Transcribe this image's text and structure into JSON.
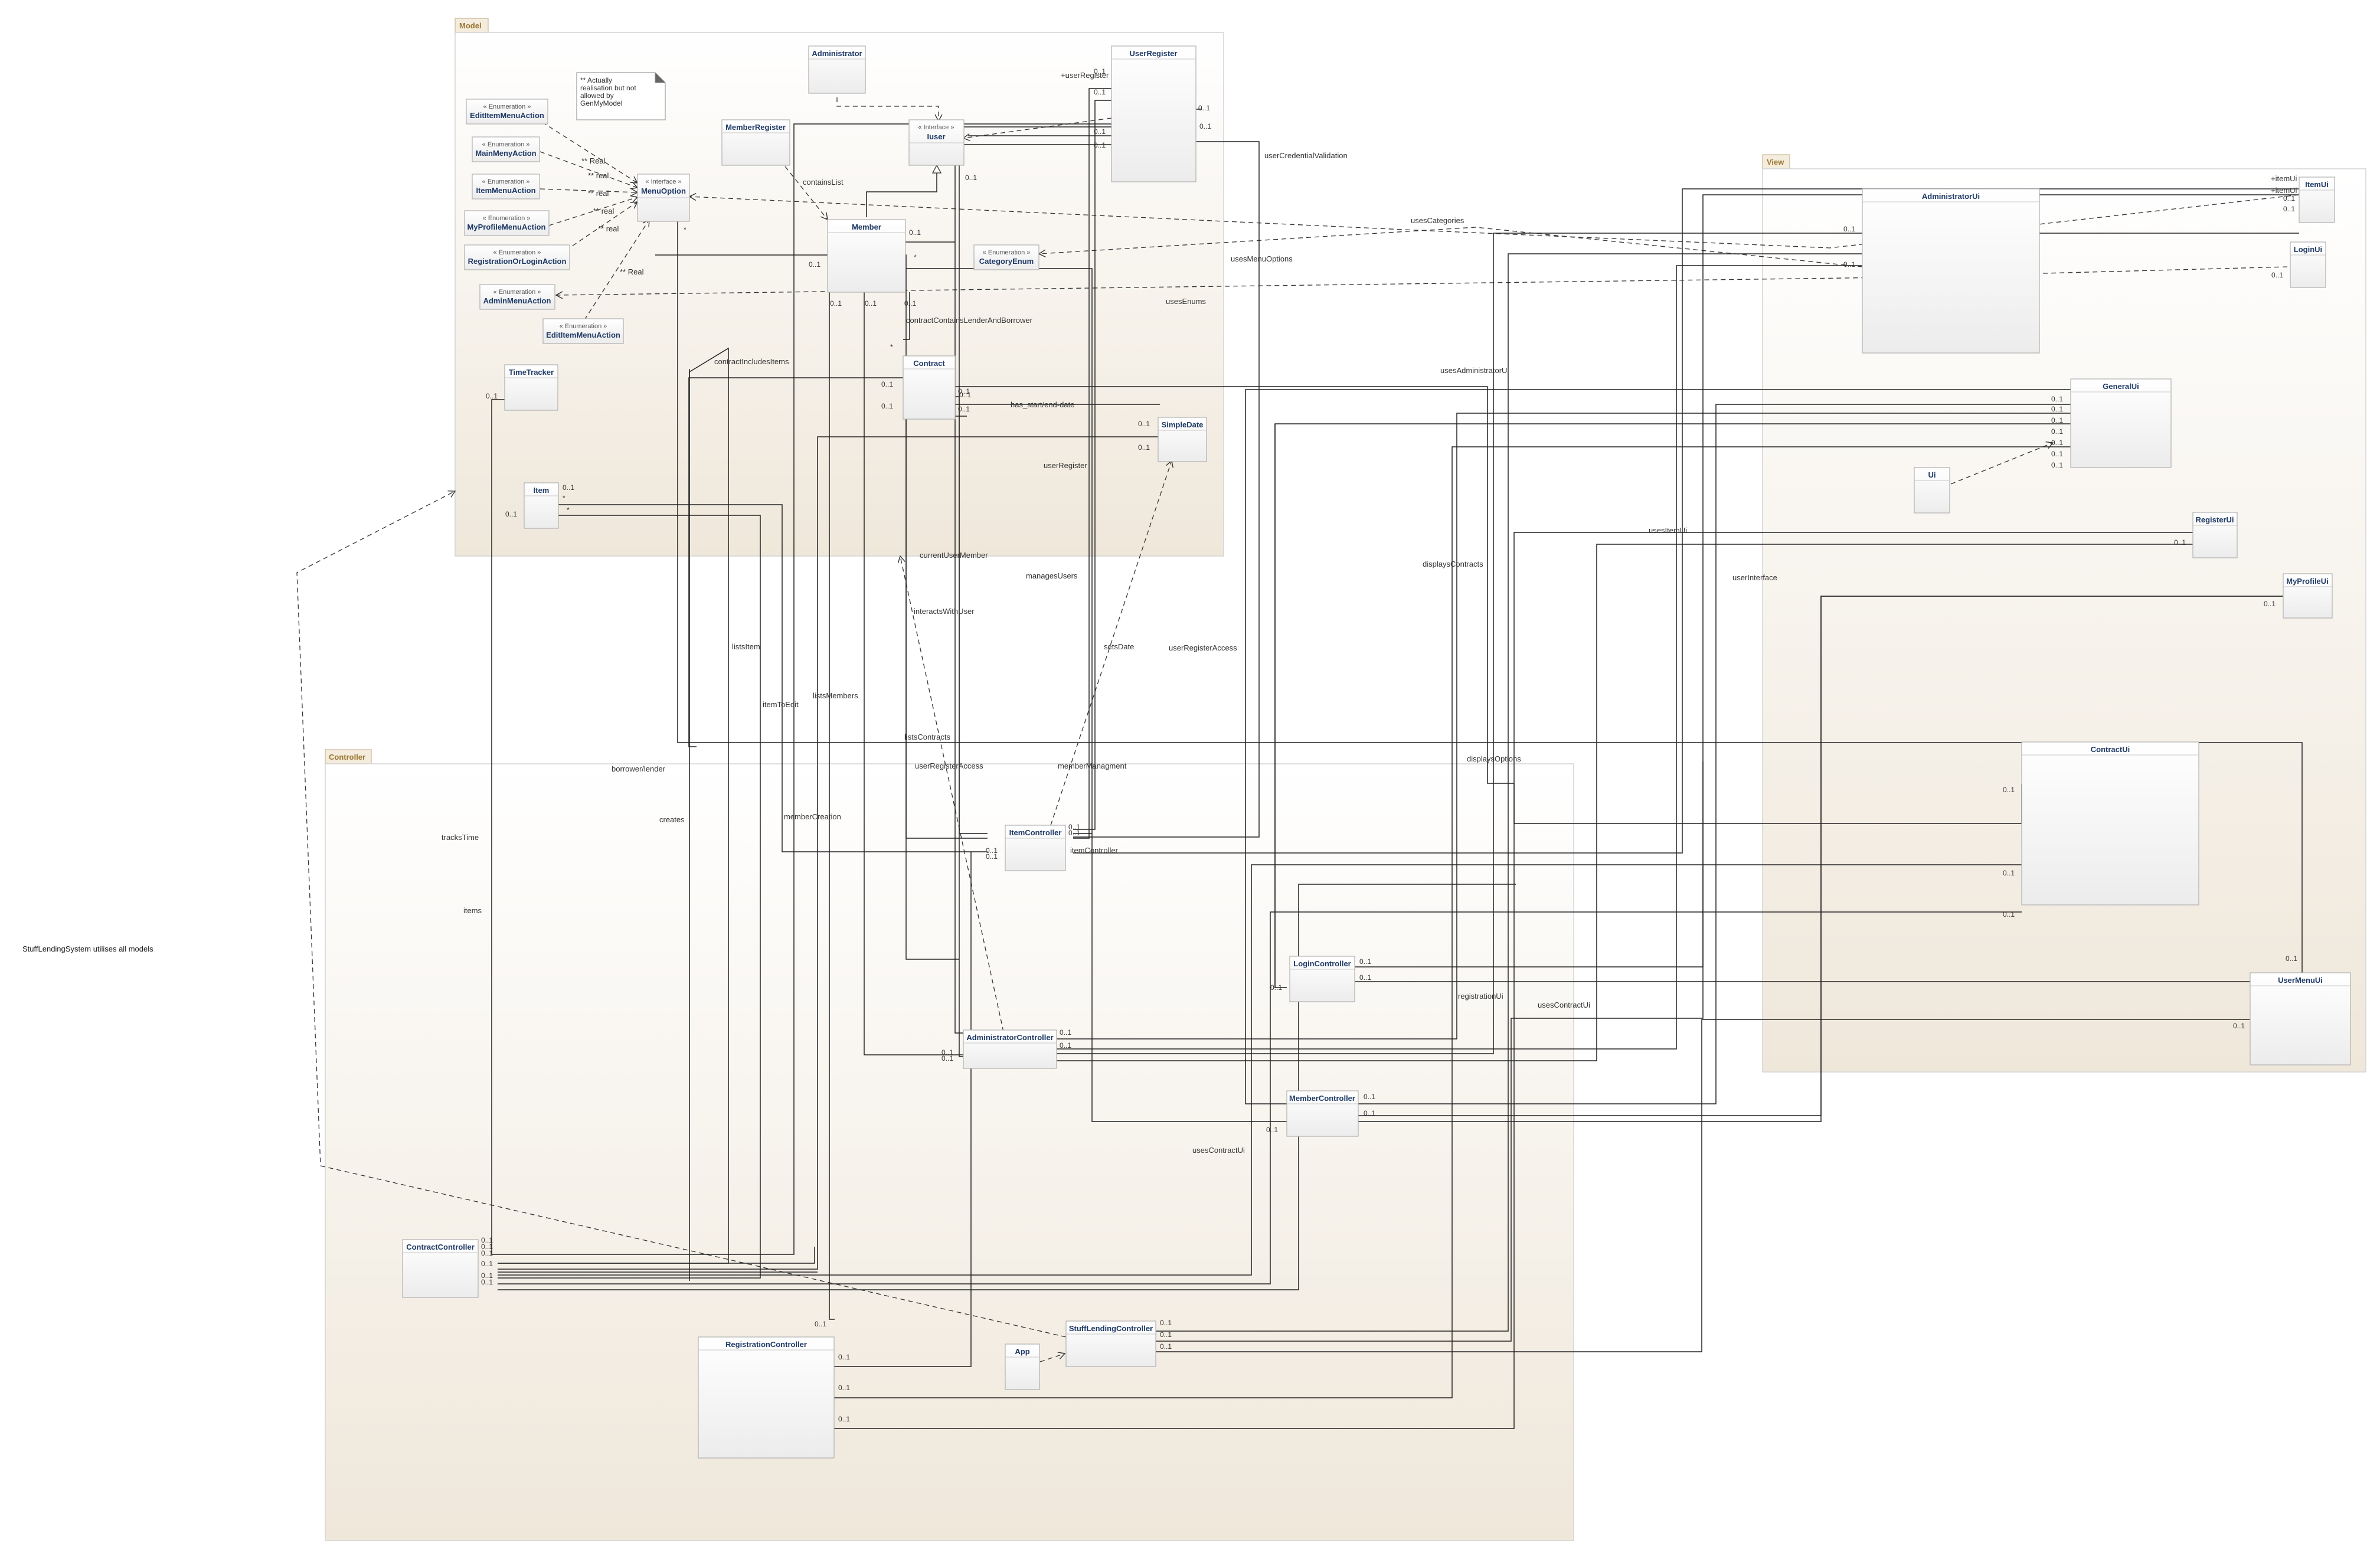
{
  "packages": {
    "model": "Model",
    "view": "View",
    "controller": "Controller"
  },
  "classes": {
    "administrator": "Administrator",
    "user_register": "UserRegister",
    "member_register": "MemberRegister",
    "iuser": "Iuser",
    "menu_option": "MenuOption",
    "edit_item_menu_action": "EditItemMenuAction",
    "main_meny_action": "MainMenyAction",
    "item_menu_action": "ItemMenuAction",
    "my_profile_menu_action": "MyProfileMenuAction",
    "registration_or_login_action": "RegistrationOrLoginAction",
    "admin_menu_action": "AdminMenuAction",
    "edit_item_menu_action_2": "EditItemMenuAction",
    "member": "Member",
    "category_enum": "CategoryEnum",
    "contract": "Contract",
    "time_tracker": "TimeTracker",
    "simple_date": "SimpleDate",
    "item": "Item",
    "administrator_ui": "AdministratorUi",
    "item_ui": "ItemUi",
    "login_ui": "LoginUi",
    "general_ui": "GeneralUi",
    "ui": "Ui",
    "register_ui": "RegisterUi",
    "my_profile_ui": "MyProfileUi",
    "contract_ui": "ContractUi",
    "user_menu_ui": "UserMenuUi",
    "item_controller": "ItemController",
    "login_controller": "LoginController",
    "administrator_controller": "AdministratorController",
    "member_controller": "MemberController",
    "contract_controller": "ContractController",
    "registration_controller": "RegistrationController",
    "app": "App",
    "stuff_lending_controller": "StuffLendingController"
  },
  "stereotypes": {
    "interface": "« Interface »",
    "enumeration": "« Enumeration »"
  },
  "note": {
    "lines": [
      "** Actually",
      "realisation but not",
      "allowed by",
      "GenMyModel"
    ]
  },
  "free_text": {
    "system_note": "StuffLendingSystem utilises all models"
  },
  "edge_labels": {
    "user_register_role": "+userRegister",
    "real1": "** Real",
    "real2": "** real",
    "real3": "** real",
    "real4": "** real",
    "real5": "** real",
    "real6": "** Real",
    "contains_list": "containsList",
    "user_credential_validation": "userCredentialValidation",
    "uses_menu_options": "usesMenuOptions",
    "uses_enums": "usesEnums",
    "uses_categories": "usesCategories",
    "contract_contains": "contractContainsLenderAndBorrower",
    "contract_includes_items": "contractIncludesItems",
    "has_start_end_date": "has_start/end-date",
    "user_register": "userRegister",
    "uses_administrator_ui": "usesAdministratorUi",
    "current_user_member": "currentUserMember",
    "manages_users": "managesUsers",
    "interacts_with_user": "interactsWithUser",
    "displays_contracts": "displaysContracts",
    "uses_item_ui": "usesItemUi",
    "user_interface": "userInterface",
    "lists_item": "listsItem",
    "sets_date": "setsDate",
    "user_register_access": "userRegisterAccess",
    "item_to_edit": "itemToEdit",
    "lists_members": "listsMembers",
    "lists_contracts": "listsContracts",
    "borrower_lender": "borrower/lender",
    "user_register_access_2": "userRegisterAccess",
    "member_managment": "memberManagment",
    "displays_options": "displaysOptions",
    "creates": "creates",
    "member_creation": "memberCreation",
    "tracks_time": "tracksTime",
    "item_controller_role": "itemController",
    "items": "items",
    "registration_ui": "registrationUi",
    "uses_contract_ui_1": "usesContractUi",
    "uses_contract_ui_2": "usesContractUi",
    "item_ui_role": "+itemUi",
    "item_ui_role_2": "+itemUi"
  },
  "multiplicities": {
    "m01": "0..1",
    "many": "*"
  }
}
